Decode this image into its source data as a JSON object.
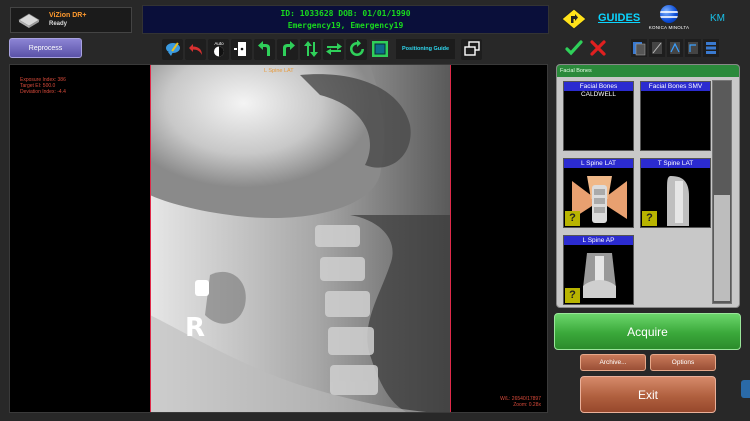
{
  "app": {
    "name": "ViZion DR+",
    "status": "Ready"
  },
  "patient": {
    "id_label": "ID:",
    "id": "1033628",
    "dob_label": "DOB:",
    "dob": "01/01/1990",
    "name": "Emergency19, Emergency19"
  },
  "header": {
    "guides_label": "GUIDES",
    "brand_caption": "KONICA MINOLTA",
    "user_initials": "KM"
  },
  "toolbar": {
    "reprocess_label": "Reprocess",
    "auto_label": "Auto",
    "positioning_guide_label": "Positioning Guide"
  },
  "viewer": {
    "view_title": "L Spine LAT",
    "exposure_index": "Exposure Index: 386",
    "target_ei": "Target EI: 500.0",
    "deviation_index": "Deviation Index: -4.4",
    "wl": "W/L: 26540/17897",
    "zoom": "Zoom: 0.28x",
    "marker": "R"
  },
  "protocol_panel": {
    "title": "Facial Bones",
    "items": [
      {
        "label": "Facial Bones",
        "sublabel": "CALDWELL",
        "help": ""
      },
      {
        "label": "Facial Bones SMV",
        "sublabel": "",
        "help": ""
      },
      {
        "label": "L Spine LAT",
        "sublabel": "",
        "help": "?"
      },
      {
        "label": "T Spine LAT",
        "sublabel": "",
        "help": "?"
      },
      {
        "label": "L Spine AP",
        "sublabel": "",
        "help": "?"
      }
    ]
  },
  "actions": {
    "acquire_label": "Acquire",
    "archive_label": "Archive...",
    "options_label": "Options",
    "exit_label": "Exit"
  },
  "colors": {
    "acquire": "#3aa83a",
    "exit": "#b0603f",
    "patient_text": "#19d91e",
    "accent_cyan": "#0bd5ff"
  }
}
